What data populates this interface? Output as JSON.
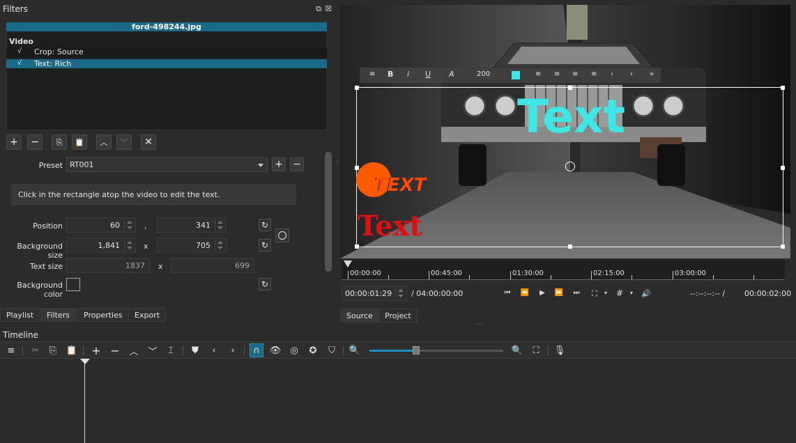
{
  "filters_panel": {
    "title": "Filters",
    "file_name": "ford-498244.jpg",
    "group_label": "Video",
    "filters": [
      {
        "check": "√",
        "label": "Crop: Source"
      },
      {
        "check": "√",
        "label": "Text: Rich"
      }
    ],
    "preset_label": "Preset",
    "preset_value": "RT001",
    "info_text": "Click in the rectangle atop the video to edit the text.",
    "position_label": "Position",
    "position_x": "60",
    "position_sep": ",",
    "position_y": "341",
    "bg_size_label": "Background size",
    "bg_size_w": "1,841",
    "bg_size_sep": "x",
    "bg_size_h": "705",
    "text_size_label": "Text size",
    "text_size_w": "1837",
    "text_size_sep": "x",
    "text_size_h": "699",
    "bg_color_label": "Background color"
  },
  "left_tabs": [
    "Playlist",
    "Filters",
    "Properties",
    "Export"
  ],
  "player": {
    "font_size_value": "200",
    "overlay_text_cyan": "Text",
    "overlay_text_logo": "TEXT",
    "overlay_text_red": "Text",
    "ruler_labels": [
      "00:00:00",
      "00:45:00",
      "01:30:00",
      "02:15:00",
      "03:00:00"
    ],
    "timecode": "00:00:01:29",
    "duration": "/ 04:00:00:00",
    "in_out": "--:--:--:-- /",
    "selection_duration": "00:00:02:00"
  },
  "player_tabs": [
    "Source",
    "Project"
  ],
  "timeline": {
    "title": "Timeline"
  },
  "colors": {
    "accent": "#1b6a8a",
    "cyan_text": "#3ee6e6",
    "red_text": "#e01010",
    "logo_orange": "#ff5a00",
    "zoom_slider": "#1d8fc4"
  }
}
